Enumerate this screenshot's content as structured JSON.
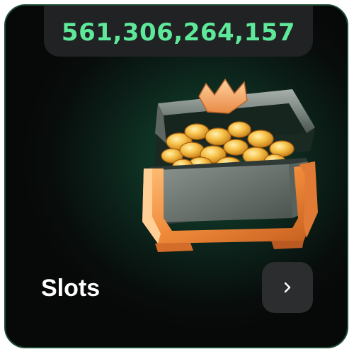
{
  "jackpot": {
    "value": "561,306,264,157",
    "color": "#5ee89a"
  },
  "game": {
    "title": "Slots",
    "icon": "treasure-chest-icon"
  },
  "open_button": {
    "icon": "chevron-right-icon"
  }
}
